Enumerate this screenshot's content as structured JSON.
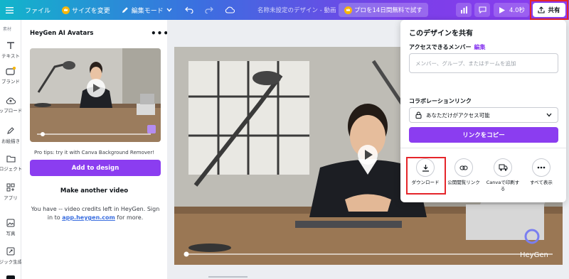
{
  "toolbar": {
    "file": "ファイル",
    "resize": "サイズを変更",
    "edit_mode": "編集モード",
    "doc_title": "名称未設定のデザイン - 動画",
    "trial": "プロを14日間無料で試す",
    "duration": "4.0秒",
    "share": "共有"
  },
  "rail": {
    "top_label": "素材",
    "items": [
      "テキスト",
      "ブランド",
      "ップロード",
      "お絵描き",
      "ロジェクト",
      "アプリ",
      "写真",
      "ジック生成"
    ]
  },
  "panel": {
    "title": "HeyGen AI Avatars",
    "pro_tips": "Pro tips: try it with Canva Background Remover!",
    "add_button": "Add to design",
    "make_another": "Make another video",
    "credits_text": "You have -- video credits left in HeyGen. Sign in to",
    "credits_link": "app.heygen.com",
    "credits_suffix": "for more."
  },
  "watermark": "HeyGen",
  "share": {
    "title": "このデザインを共有",
    "access_label": "アクセスできるメンバー",
    "edit": "編集",
    "input_placeholder": "メンバー、グループ、またはチームを追加",
    "collab_label": "コラボレーションリンク",
    "access_value": "あなただけがアクセス可能",
    "copy_button": "リンクをコピー",
    "actions": [
      "ダウンロード",
      "公開閲覧リンク",
      "Canvaで印刷す\nる",
      "すべて表示"
    ]
  },
  "colors": {
    "accent": "#8b3df0",
    "highlight": "#e5252a"
  }
}
